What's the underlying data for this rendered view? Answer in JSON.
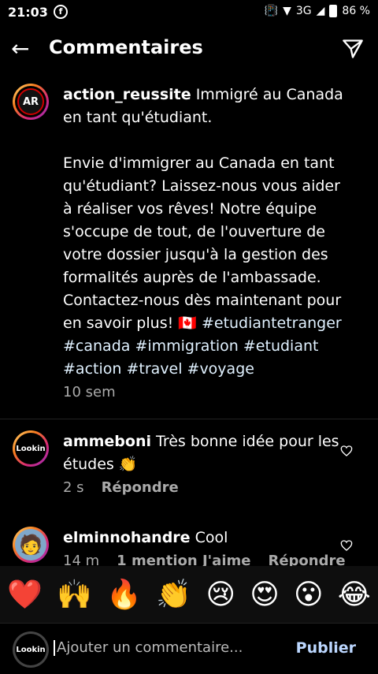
{
  "status": {
    "time": "21:03",
    "battery": "86 %",
    "network": "3G"
  },
  "header": {
    "title": "Commentaires"
  },
  "caption": {
    "username": "action_reussite",
    "text_part1": " Immigré au Canada en tant qu'étudiant.\n\nEnvie d'immigrer au Canada en tant qu'étudiant? Laissez-nous vous aider à réaliser vos rêves! Notre équipe s'occupe de tout, de l'ouverture de votre dossier jusqu'à la gestion des formalités auprès de l'ambassade. Contactez-nous dès maintenant pour en savoir plus! 🇨🇦 ",
    "hashtags": "#etudiantetranger #canada #immigration #etudiant #action #travel #voyage",
    "time": "10 sem",
    "avatar_text": "AR"
  },
  "comments": [
    {
      "username": "ammeboni",
      "text": " Très bonne idée pour les études 👏",
      "time": "2 s",
      "reply": "Répondre",
      "avatar_text": "Lookin"
    },
    {
      "username": "elminnohandre",
      "text": " Cool",
      "time": "14 m",
      "likes": "1 mention J'aime",
      "reply": "Répondre",
      "avatar_text": "🧑"
    }
  ],
  "reactions": [
    "❤️",
    "🙌",
    "🔥",
    "👏",
    "😢",
    "😍",
    "😮",
    "😂"
  ],
  "compose": {
    "placeholder": "Ajouter un commentaire...",
    "publish": "Publier",
    "avatar_text": "Lookin"
  }
}
